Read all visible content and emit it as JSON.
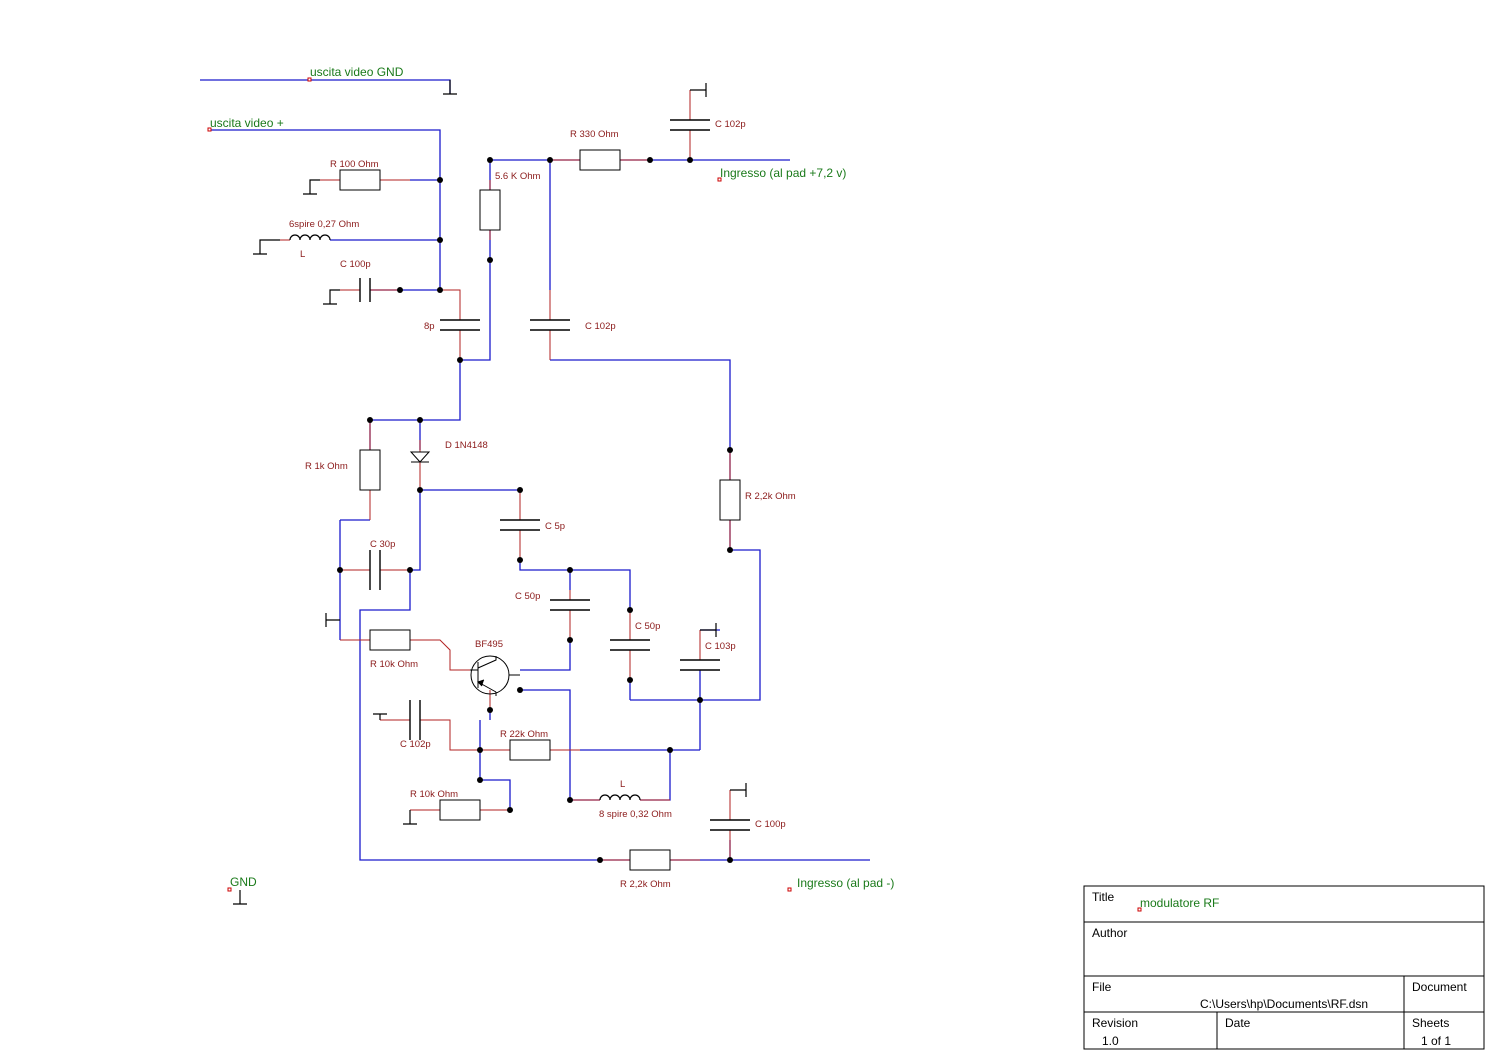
{
  "net_labels": {
    "video_gnd": "uscita video GND",
    "video_plus": "uscita video +",
    "input_plus": "Ingresso (al pad +7,2 v)",
    "gnd": "GND",
    "input_minus": "Ingresso (al pad -)"
  },
  "components": {
    "r100": "R 100 Ohm",
    "l6": "6spire 0,27 Ohm",
    "l6_letter": "L",
    "c100p_top": "C 100p",
    "c8p": "8p",
    "r56k": "5.6 K Ohm",
    "r330": "R 330 Ohm",
    "c102p_top": "C 102p",
    "c102p_mid": "C 102p",
    "d1": "D 1N4148",
    "r1k": "R 1k Ohm",
    "c5p": "C 5p",
    "c30p": "C 30p",
    "c50p_a": "C 50p",
    "c50p_b": "C 50p",
    "c103p": "C 103p",
    "r22k_right": "R 2,2k Ohm",
    "r10k_a": "R 10k Ohm",
    "transistor": "BF495",
    "c102p_low": "C 102p",
    "r22k": "R 22k Ohm",
    "l8_letter": "L",
    "l8": "8 spire 0,32 Ohm",
    "r10k_b": "R 10k Ohm",
    "c100p_low": "C 100p",
    "r22k_bottom": "R 2,2k Ohm"
  },
  "title_block": {
    "title_label": "Title",
    "title_value": "modulatore RF",
    "author_label": "Author",
    "author_value": "",
    "file_label": "File",
    "file_value": "C:\\Users\\hp\\Documents\\RF.dsn",
    "document_label": "Document",
    "revision_label": "Revision",
    "revision_value": "1.0",
    "date_label": "Date",
    "sheets_label": "Sheets",
    "sheets_value": "1 of 1"
  },
  "colors": {
    "wire": "#1a1acc",
    "lead": "#b22222",
    "component_text": "#8b1a1a",
    "net_text": "#1a7a1a",
    "junction": "#000000"
  }
}
